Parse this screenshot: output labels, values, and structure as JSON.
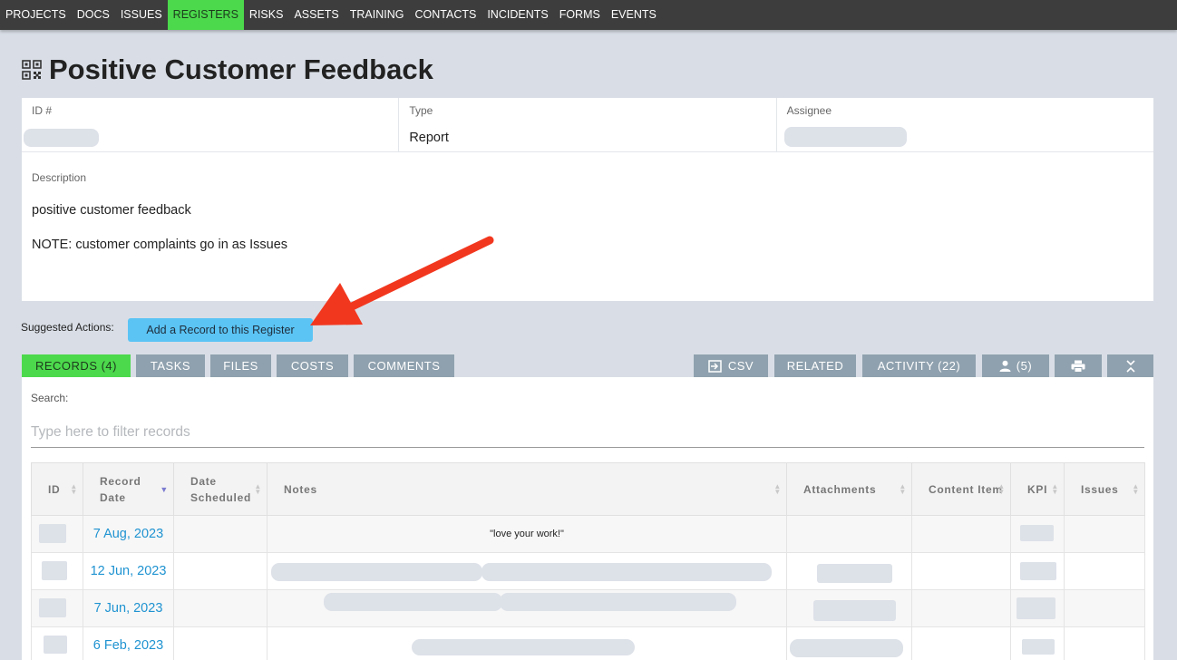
{
  "nav": {
    "items": [
      "PROJECTS",
      "DOCS",
      "ISSUES",
      "REGISTERS",
      "RISKS",
      "ASSETS",
      "TRAINING",
      "CONTACTS",
      "INCIDENTS",
      "FORMS",
      "EVENTS"
    ],
    "active": "REGISTERS"
  },
  "page": {
    "title": "Positive Customer Feedback",
    "title_icon": "qr-code-icon"
  },
  "info": {
    "id_label": "ID #",
    "type_label": "Type",
    "type_value": "Report",
    "assignee_label": "Assignee",
    "description_label": "Description",
    "description_line1": "positive customer feedback",
    "description_line2": "NOTE: customer complaints go in as Issues"
  },
  "actions": {
    "suggested_label": "Suggested Actions:",
    "add_record_label": "Add a Record to this Register"
  },
  "tabs": {
    "records": "RECORDS (4)",
    "tasks": "TASKS",
    "files": "FILES",
    "costs": "COSTS",
    "comments": "COMMENTS",
    "csv": "CSV",
    "related": "RELATED",
    "activity": "ACTIVITY (22)",
    "people": "(5)"
  },
  "records": {
    "search_label": "Search:",
    "search_placeholder": "Type here to filter records",
    "columns": [
      "ID",
      "Record Date",
      "Date Scheduled",
      "Notes",
      "Attachments",
      "Content Item",
      "KPI",
      "Issues"
    ],
    "rows": [
      {
        "record_date": "7 Aug, 2023",
        "note": "\"love your work!\""
      },
      {
        "record_date": "12 Jun, 2023",
        "note": ""
      },
      {
        "record_date": "7 Jun, 2023",
        "note": ""
      },
      {
        "record_date": "6 Feb, 2023",
        "note": ""
      }
    ]
  },
  "colors": {
    "nav_bg": "#3d3d3d",
    "active_green": "#4cd94c",
    "tab_gray": "#8fa1ae",
    "button_blue": "#5bc4f5",
    "link_blue": "#1f93d1",
    "annotation_red": "#f2371f"
  }
}
